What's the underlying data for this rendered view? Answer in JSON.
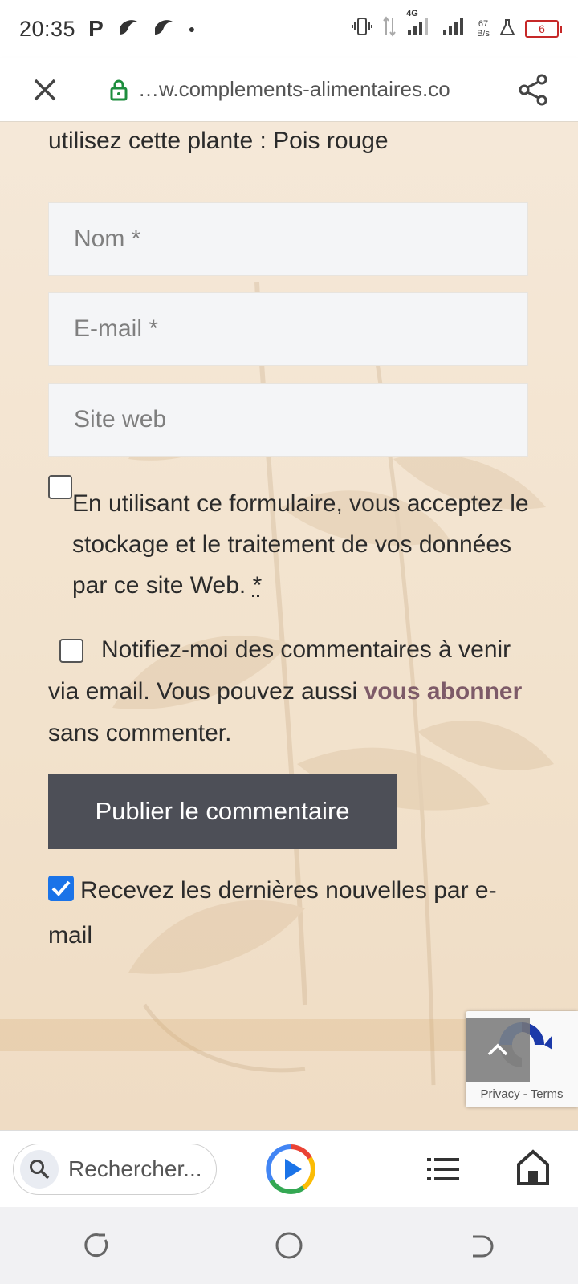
{
  "status_bar": {
    "time": "20:35",
    "network_type": "4G",
    "net_speed_value": "67",
    "net_speed_unit": "B/s",
    "battery_level": "6"
  },
  "browser": {
    "url": "…w.complements-alimentaires.co"
  },
  "page": {
    "intro_text": "utilisez cette plante : Pois rouge",
    "form": {
      "name_placeholder": "Nom *",
      "email_placeholder": "E-mail *",
      "website_placeholder": "Site web",
      "consent_text": "En utilisant ce formulaire, vous acceptez le stockage et le traitement de vos données par ce site Web.",
      "consent_required_mark": "*",
      "notify_text_before": "Notifiez-moi des commentaires à venir via email. Vous pouvez aussi",
      "notify_link": "vous abonner",
      "notify_text_after": "sans commenter.",
      "submit_label": "Publier le commentaire",
      "newsletter_label": "Recevez les dernières nouvelles par e-mail",
      "newsletter_checked": true
    }
  },
  "recaptcha": {
    "privacy_label": "Privacy",
    "separator": "-",
    "terms_label": "Terms"
  },
  "bottom_toolbar": {
    "search_placeholder": "Rechercher..."
  },
  "colors": {
    "accent_link": "#7d5a68",
    "button_bg": "#4d4f57",
    "checkbox_checked": "#1a73e8",
    "battery_low": "#c62828"
  }
}
